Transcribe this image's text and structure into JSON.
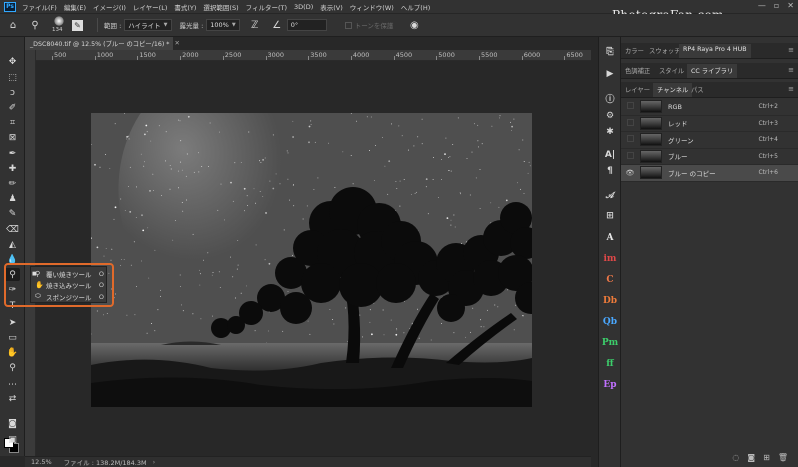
{
  "app": {
    "logo": "Ps",
    "watermark": "PhotograFan.com",
    "menu": [
      "ファイル(F)",
      "編集(E)",
      "イメージ(I)",
      "レイヤー(L)",
      "書式(Y)",
      "選択範囲(S)",
      "フィルター(T)",
      "3D(D)",
      "表示(V)",
      "ウィンドウ(W)",
      "ヘルプ(H)"
    ]
  },
  "options": {
    "brush_size": "134",
    "range_label": "範囲 :",
    "range_value": "ハイライト",
    "exposure_label": "露光量 :",
    "exposure_value": "100%",
    "angle_value": "0°",
    "protect_tones_label": "トーンを保護"
  },
  "document": {
    "tab_title": "_DSC8040.tif @ 12.5% (ブルー のコピー/16) *",
    "ruler_ticks": [
      "500",
      "1000",
      "1500",
      "2000",
      "2500",
      "3000",
      "3500",
      "4000",
      "4500",
      "5000",
      "5500",
      "6000",
      "6500"
    ]
  },
  "flyout": {
    "items": [
      {
        "label": "覆い焼きツール",
        "key": "O",
        "icon": "dodge-icon"
      },
      {
        "label": "焼き込みツール",
        "key": "O",
        "icon": "burn-icon"
      },
      {
        "label": "スポンジツール",
        "key": "O",
        "icon": "sponge-icon"
      }
    ],
    "highlight_color": "#e06a2b"
  },
  "status": {
    "zoom": "12.5%",
    "file_info": "ファイル : 138.2M/184.3M"
  },
  "panels": {
    "row1": {
      "tab1": "カラー",
      "tab2": "スウォッチ",
      "tab3": "RP4 Raya Pro 4 HUB"
    },
    "row2": {
      "tab1": "色調補正",
      "tab2": "スタイル",
      "tab3": "CC ライブラリ"
    },
    "row3": {
      "tab1": "レイヤー",
      "tab2": "チャンネル",
      "tab3": "パス"
    },
    "channels": [
      {
        "name": "RGB",
        "shortcut": "Ctrl+2",
        "visible": false
      },
      {
        "name": "レッド",
        "shortcut": "Ctrl+3",
        "visible": false
      },
      {
        "name": "グリーン",
        "shortcut": "Ctrl+4",
        "visible": false
      },
      {
        "name": "ブルー",
        "shortcut": "Ctrl+5",
        "visible": false
      },
      {
        "name": "ブルー のコピー",
        "shortcut": "Ctrl+6",
        "visible": true
      }
    ]
  },
  "strip_plugins": [
    {
      "glyph": "A",
      "color": "#e6e6e6"
    },
    {
      "glyph": "im",
      "color": "#e04848"
    },
    {
      "glyph": "C",
      "color": "#f07848"
    },
    {
      "glyph": "Db",
      "color": "#ee7b3a"
    },
    {
      "glyph": "Qb",
      "color": "#4aa8ff"
    },
    {
      "glyph": "Pm",
      "color": "#3ccf6b"
    },
    {
      "glyph": "ff",
      "color": "#3ccf6b"
    },
    {
      "glyph": "Ep",
      "color": "#c070ff"
    }
  ]
}
